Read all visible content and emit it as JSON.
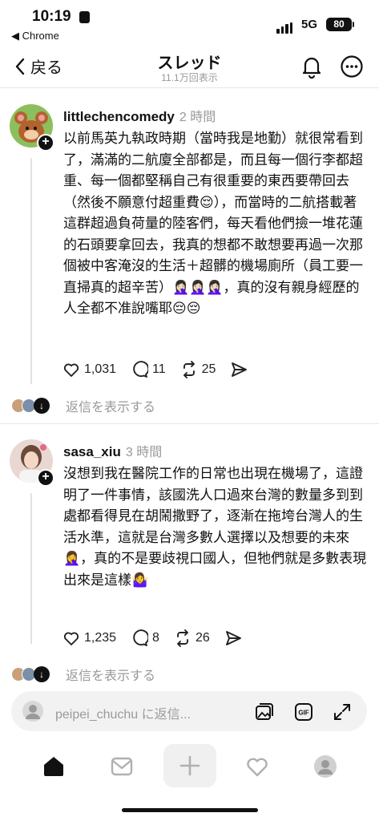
{
  "status": {
    "time": "10:19",
    "back_app": "◀ Chrome",
    "network": "5G",
    "battery": "80"
  },
  "header": {
    "back_label": "戻る",
    "title": "スレッド",
    "views": "11.1万回表示"
  },
  "posts": [
    {
      "username": "littlechencomedy",
      "time_ago": "2 時間",
      "text": "以前馬英九執政時期（當時我是地勤）就很常看到了，滿滿的二航廈全部都是，而且每一個行李都超重、每一個都堅稱自己有很重要的東西要帶回去（然後不願意付超重費😌），而當時的二航搭載著這群超過負荷量的陸客們，每天看他們撿一堆花蓮的石頭要拿回去，我真的想都不敢想要再過一次那個被中客淹沒的生活＋超髒的機場廁所（員工要一直掃真的超辛苦）🤦🏻‍♀️🤦🏻‍♀️🤦🏻‍♀️，真的沒有親身經歷的人全都不准說嘴耶😔😔",
      "likes": "1,031",
      "comments": "11",
      "reposts": "25",
      "replies_label": "返信を表示する"
    },
    {
      "username": "sasa_xiu",
      "time_ago": "3 時間",
      "text": "沒想到我在醫院工作的日常也出現在機場了，這證明了一件事情，該國洗人口過來台灣的數量多到到處都看得見在胡鬧撒野了，逐漸在拖垮台灣人的生活水準，這就是台灣多數人選擇以及想要的未來🤦‍♀️，真的不是要歧視口國人，但牠們就是多數表現出來是這樣🤷‍♀️",
      "likes": "1,235",
      "comments": "8",
      "reposts": "26",
      "replies_label": "返信を表示する"
    }
  ],
  "reply_bar": {
    "placeholder": "peipei_chuchu に返信..."
  },
  "icons": [
    "back-chevron-icon",
    "bell-icon",
    "more-icon",
    "heart-icon",
    "comment-icon",
    "repost-icon",
    "share-icon",
    "image-icon",
    "gif-icon",
    "expand-icon",
    "home-icon",
    "inbox-icon",
    "plus-icon",
    "activity-icon",
    "profile-icon"
  ]
}
